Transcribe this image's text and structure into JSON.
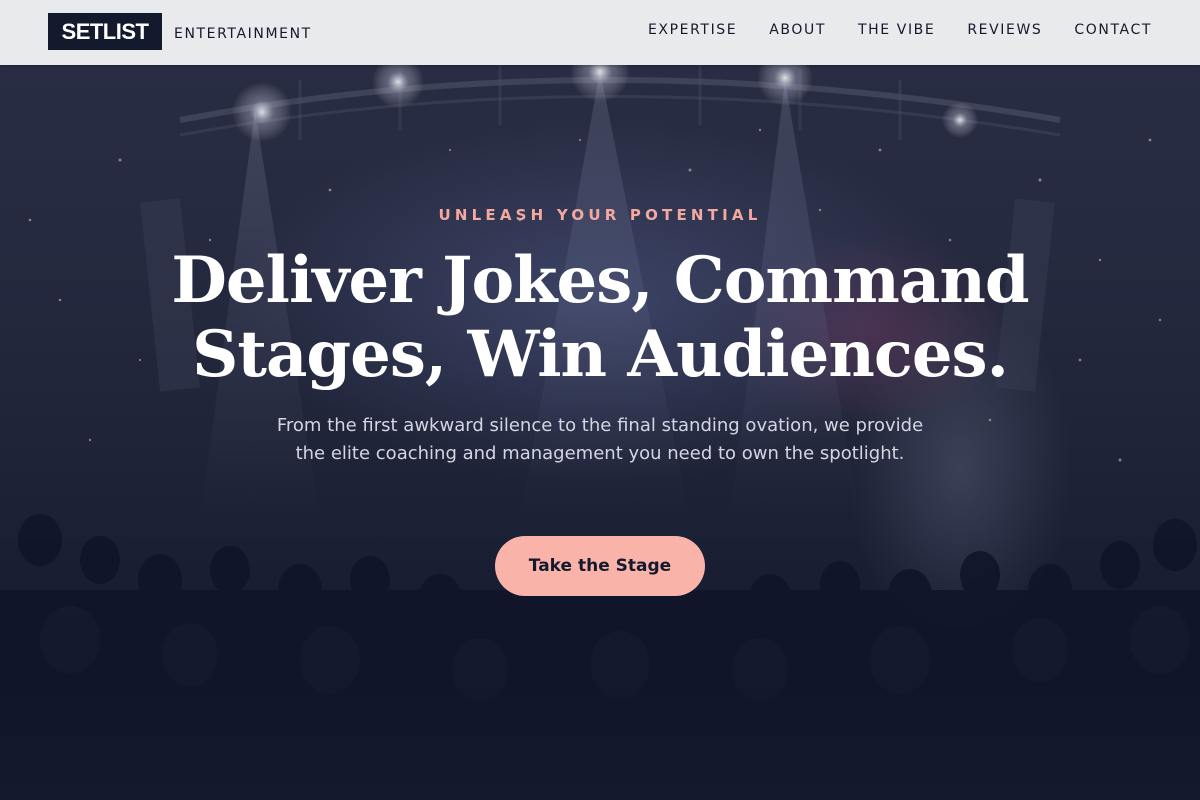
{
  "brand": {
    "logo": "SETLIST",
    "subtitle": "ENTERTAINMENT"
  },
  "nav": {
    "items": [
      {
        "label": "EXPERTISE"
      },
      {
        "label": "ABOUT"
      },
      {
        "label": "THE VIBE"
      },
      {
        "label": "REVIEWS"
      },
      {
        "label": "CONTACT"
      }
    ]
  },
  "hero": {
    "eyebrow": "UNLEASH YOUR POTENTIAL",
    "headline_line1": "Deliver Jokes, Command",
    "headline_line2": "Stages, Win Audiences.",
    "subtext": "From the first awkward silence to the final standing ovation, we provide the elite coaching and management you need to own the spotlight.",
    "cta_label": "Take the Stage"
  },
  "colors": {
    "accent": "#fab3a8",
    "eyebrow": "#f4a9a0",
    "navy": "#141a2e",
    "header_bg": "#e9eaec"
  }
}
